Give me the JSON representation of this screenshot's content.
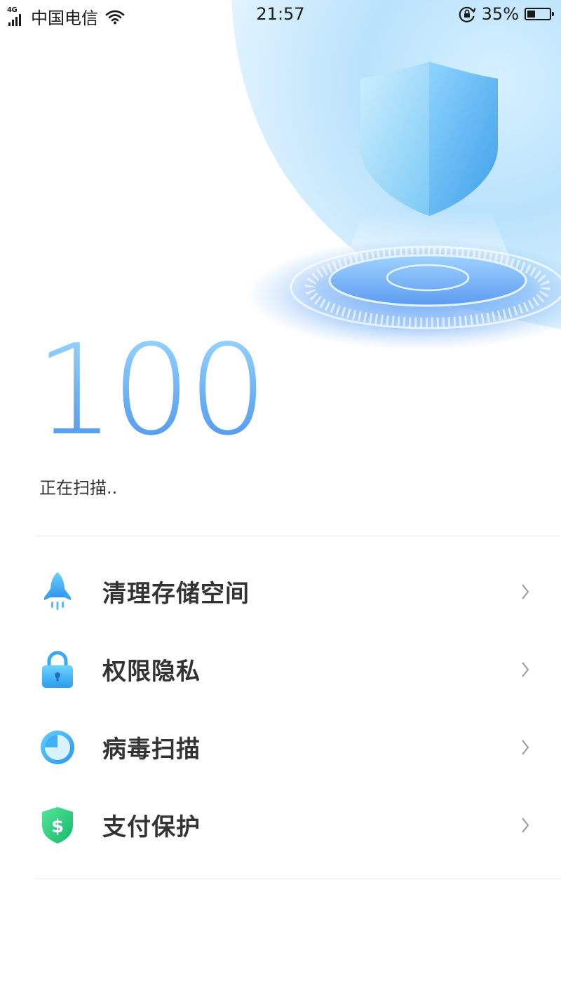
{
  "status_bar": {
    "network_type": "4G",
    "carrier": "中国电信",
    "time": "21:57",
    "battery_percent": "35%",
    "battery_level": 0.35,
    "icons": [
      "signal-icon",
      "wifi-icon",
      "rotation-lock-icon",
      "battery-icon"
    ]
  },
  "hero": {
    "score": "100",
    "status_text": "正在扫描..",
    "icons": [
      "shield-icon",
      "scan-platform"
    ]
  },
  "menu": {
    "items": [
      {
        "label": "清理存储空间",
        "icon": "rocket-icon"
      },
      {
        "label": "权限隐私",
        "icon": "lock-icon"
      },
      {
        "label": "病毒扫描",
        "icon": "virus-scan-icon"
      },
      {
        "label": "支付保护",
        "icon": "payment-shield-icon"
      }
    ]
  },
  "colors": {
    "score_gradient_top": "#9cd7ff",
    "score_gradient_bottom": "#4f95ee",
    "accent_blue": "#45a8f5",
    "payment_green": "#2fd47f",
    "divider": "#ececec"
  }
}
